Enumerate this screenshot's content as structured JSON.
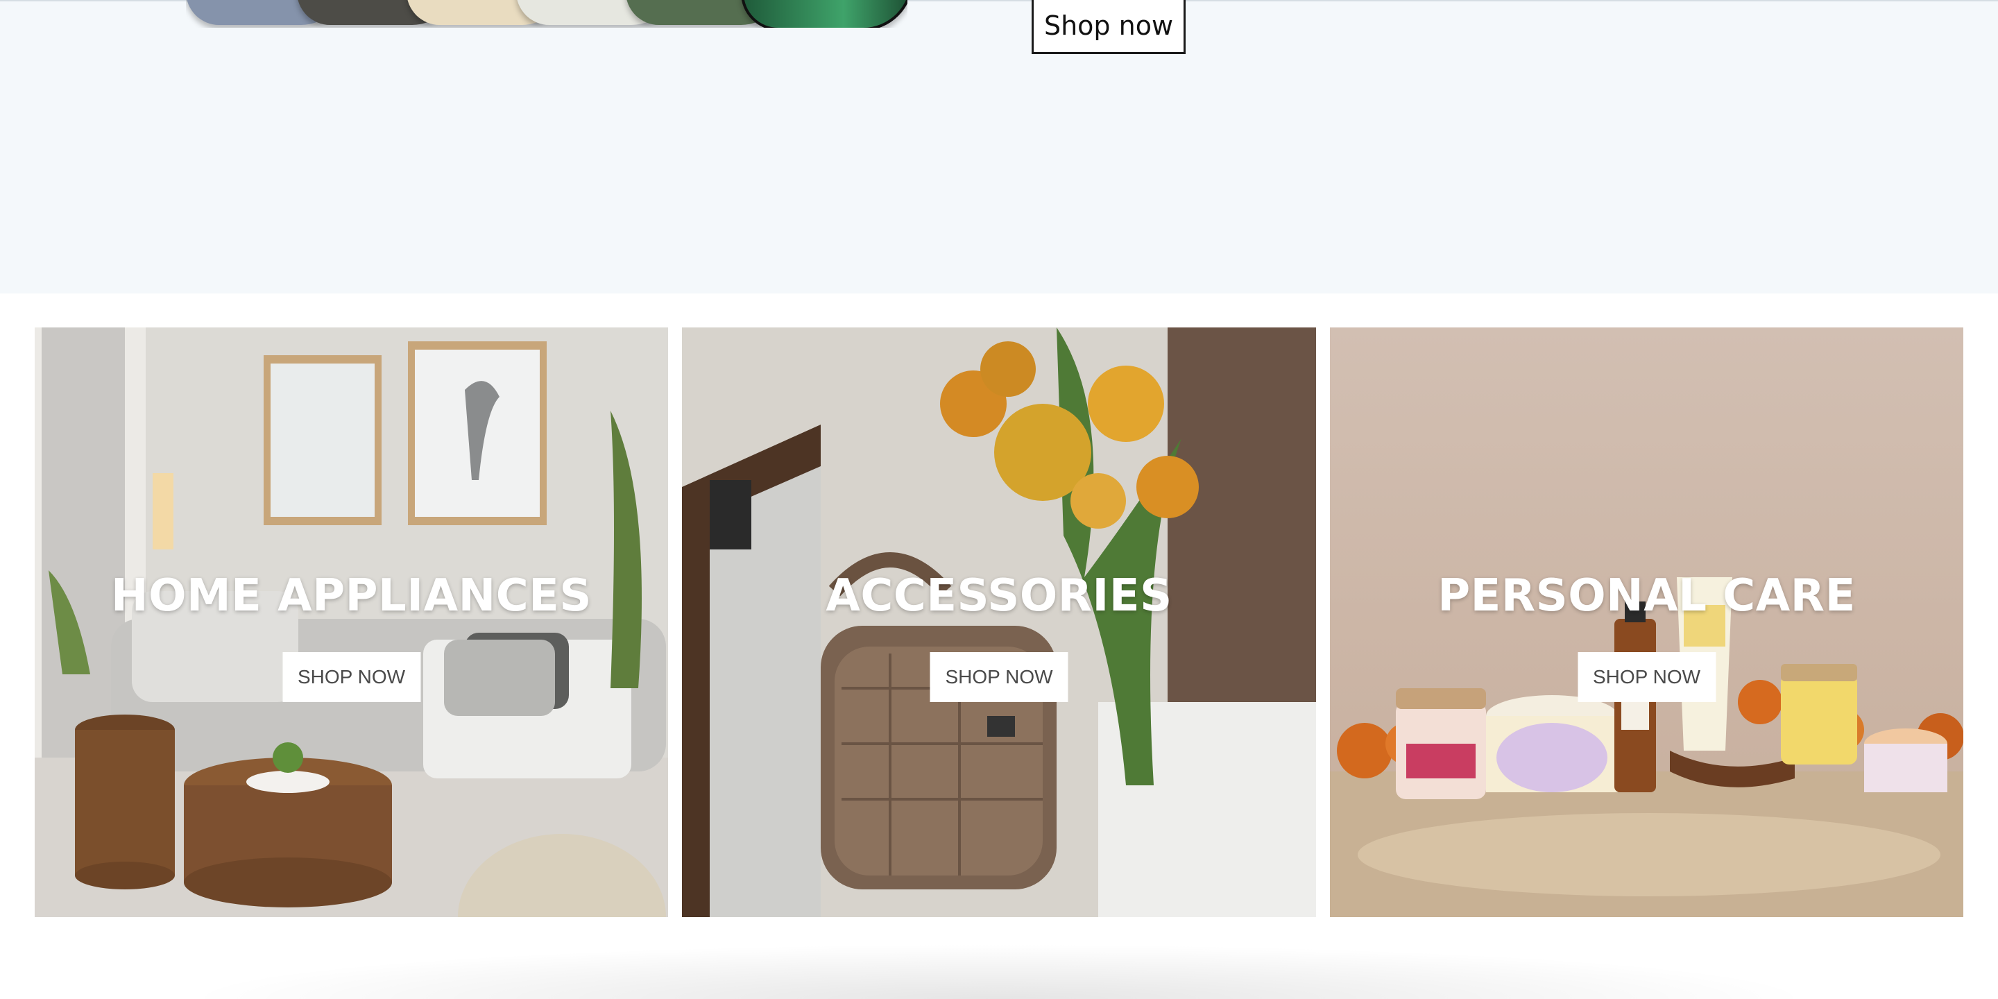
{
  "hero": {
    "shop_label": "Shop now",
    "phone_colors": [
      "#8593ab",
      "#4d4c47",
      "#e9dcc0",
      "#e6e7e0",
      "#556e50",
      "#2f7d4f"
    ]
  },
  "categories": [
    {
      "title": "HOME APPLIANCES",
      "button_label": "SHOP NOW",
      "image": "living-room-scene"
    },
    {
      "title": "ACCESSORIES",
      "button_label": "SHOP NOW",
      "image": "handbag-with-flowers"
    },
    {
      "title": "PERSONAL CARE",
      "button_label": "SHOP NOW",
      "image": "cosmetics-with-marigolds"
    }
  ]
}
